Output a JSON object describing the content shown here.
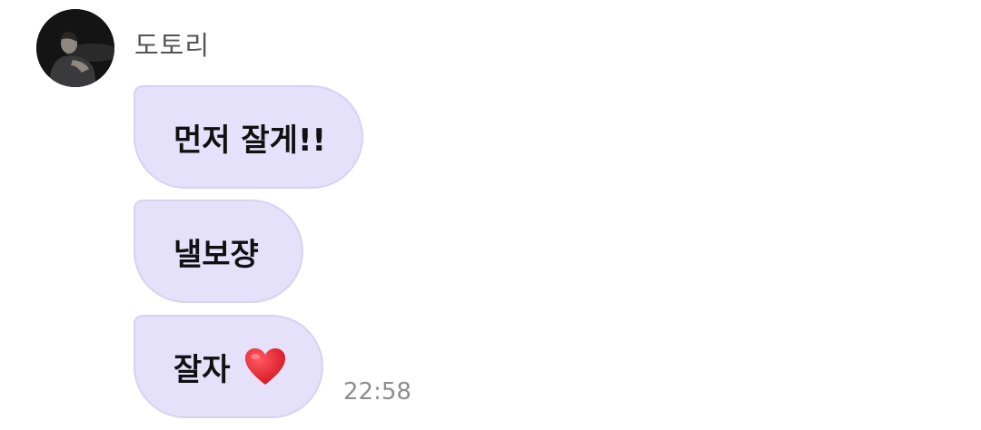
{
  "sender": {
    "name": "도토리",
    "avatar_icon": "profile-photo"
  },
  "messages": [
    {
      "text": "먼저 잘게!!"
    },
    {
      "text": "낼보쟝"
    },
    {
      "text": "잘자",
      "emoji": "red-heart-icon"
    }
  ],
  "timestamp": "22:58",
  "colors": {
    "bubble": "#e5e1fa",
    "bubble_border": "#d7d2f1",
    "heart": "#e0202e",
    "sender_text": "#555555",
    "time_text": "#8e8e8e"
  }
}
